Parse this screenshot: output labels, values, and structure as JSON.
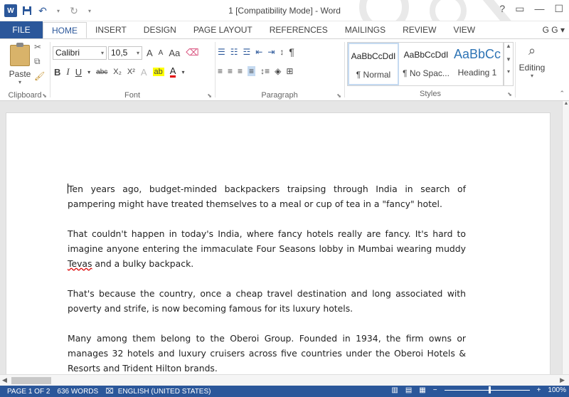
{
  "window": {
    "title": "1 [Compatibility Mode] - Word",
    "help": "?",
    "restore_ribbon": "▭",
    "minimize": "—",
    "maximize": "☐",
    "close": "✕"
  },
  "quick_access": {
    "app_icon": "W",
    "save_icon": "save-icon",
    "undo_icon": "undo-icon",
    "redo_icon": "redo-icon",
    "customize_icon": "chevron-down-icon"
  },
  "tabs": [
    {
      "label": "FILE"
    },
    {
      "label": "HOME"
    },
    {
      "label": "INSERT"
    },
    {
      "label": "DESIGN"
    },
    {
      "label": "PAGE LAYOUT"
    },
    {
      "label": "REFERENCES"
    },
    {
      "label": "MAILINGS"
    },
    {
      "label": "REVIEW"
    },
    {
      "label": "VIEW"
    }
  ],
  "user": "G G",
  "ribbon": {
    "clipboard": {
      "label": "Clipboard",
      "paste": "Paste"
    },
    "font": {
      "label": "Font",
      "font_name": "Calibri",
      "font_size": "10,5",
      "grow": "A",
      "shrink": "A",
      "change_case": "Aa",
      "bold": "B",
      "italic": "I",
      "underline": "U",
      "strikethrough": "abc",
      "subscript": "X₂",
      "superscript": "X²",
      "font_color": "A"
    },
    "paragraph": {
      "label": "Paragraph",
      "pilcrow": "¶"
    },
    "styles": {
      "label": "Styles",
      "items": [
        {
          "sample": "AaBbCcDdI",
          "name": "¶ Normal"
        },
        {
          "sample": "AaBbCcDdI",
          "name": "¶ No Spac..."
        },
        {
          "sample": "AaBbCc",
          "name": "Heading 1"
        }
      ]
    },
    "editing": {
      "label": "Editing"
    }
  },
  "document": {
    "paragraphs": [
      "Ten years ago, budget-minded backpackers traipsing through India in search of pampering might have treated themselves to a meal or cup of tea in a \"fancy\" hotel.",
      "That couldn't happen in today's India, where fancy hotels really are fancy. It's hard to imagine anyone entering the immaculate Four Seasons lobby in Mumbai wearing muddy ",
      "That's because the country, once a cheap travel destination and long associated with poverty and strife, is now becoming famous for its luxury hotels.",
      "Many among them belong to the Oberoi Group. Founded in 1934, the firm owns or manages 32 hotels and luxury cruisers across five countries under the Oberoi Hotels & Resorts and Trident Hilton brands."
    ],
    "p2_misspelled": "Tevas",
    "p2_tail": " and a bulky backpack."
  },
  "status": {
    "page": "PAGE 1 OF 2",
    "words": "636 WORDS",
    "language": "ENGLISH (UNITED STATES)",
    "zoom": "100%",
    "zoom_minus": "−",
    "zoom_plus": "+",
    "zoom_level_percent": 100
  },
  "colors": {
    "accent": "#2b579a",
    "highlight": "#ffff00",
    "font_color": "#e00000"
  }
}
